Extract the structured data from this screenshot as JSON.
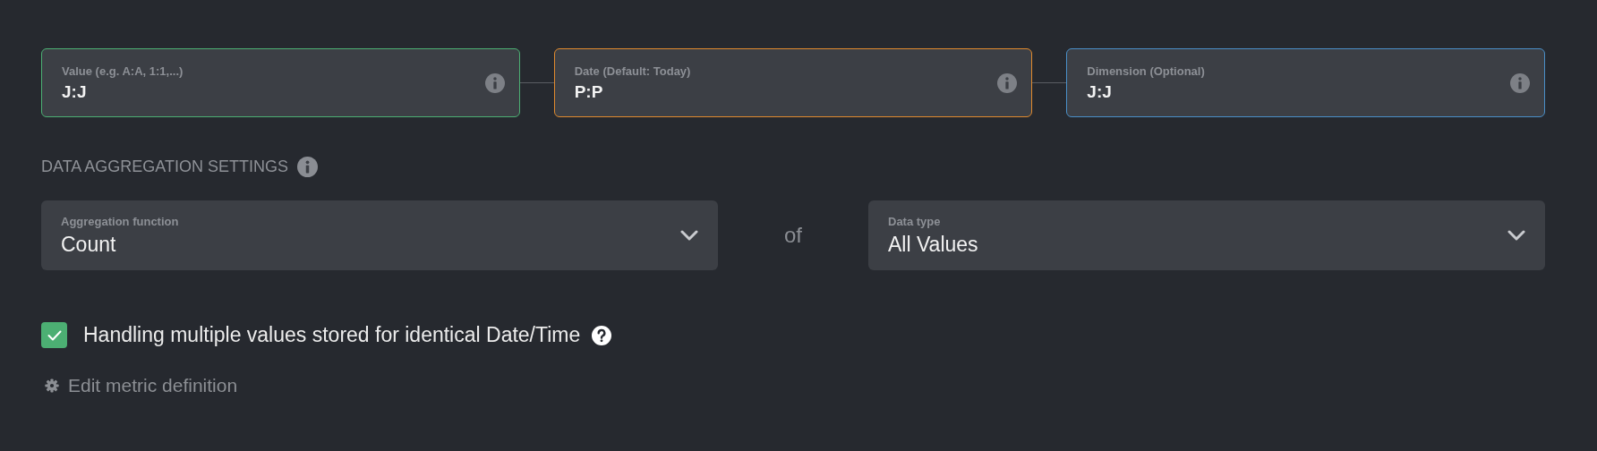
{
  "inputs": [
    {
      "label": "Value (e.g. A:A, 1:1,...)",
      "value": "J:J",
      "color": "#4caf73"
    },
    {
      "label": "Date (Default: Today)",
      "value": "P:P",
      "color": "#e08a2e"
    },
    {
      "label": "Dimension (Optional)",
      "value": "J:J",
      "color": "#4a8fc8"
    }
  ],
  "section_title": "DATA AGGREGATION SETTINGS",
  "aggregation": {
    "function": {
      "label": "Aggregation function",
      "value": "Count"
    },
    "joiner": "of",
    "data_type": {
      "label": "Data type",
      "value": "All Values"
    }
  },
  "checkbox": {
    "label": "Handling multiple values stored for identical Date/Time",
    "checked": true
  },
  "edit_link": "Edit metric definition"
}
